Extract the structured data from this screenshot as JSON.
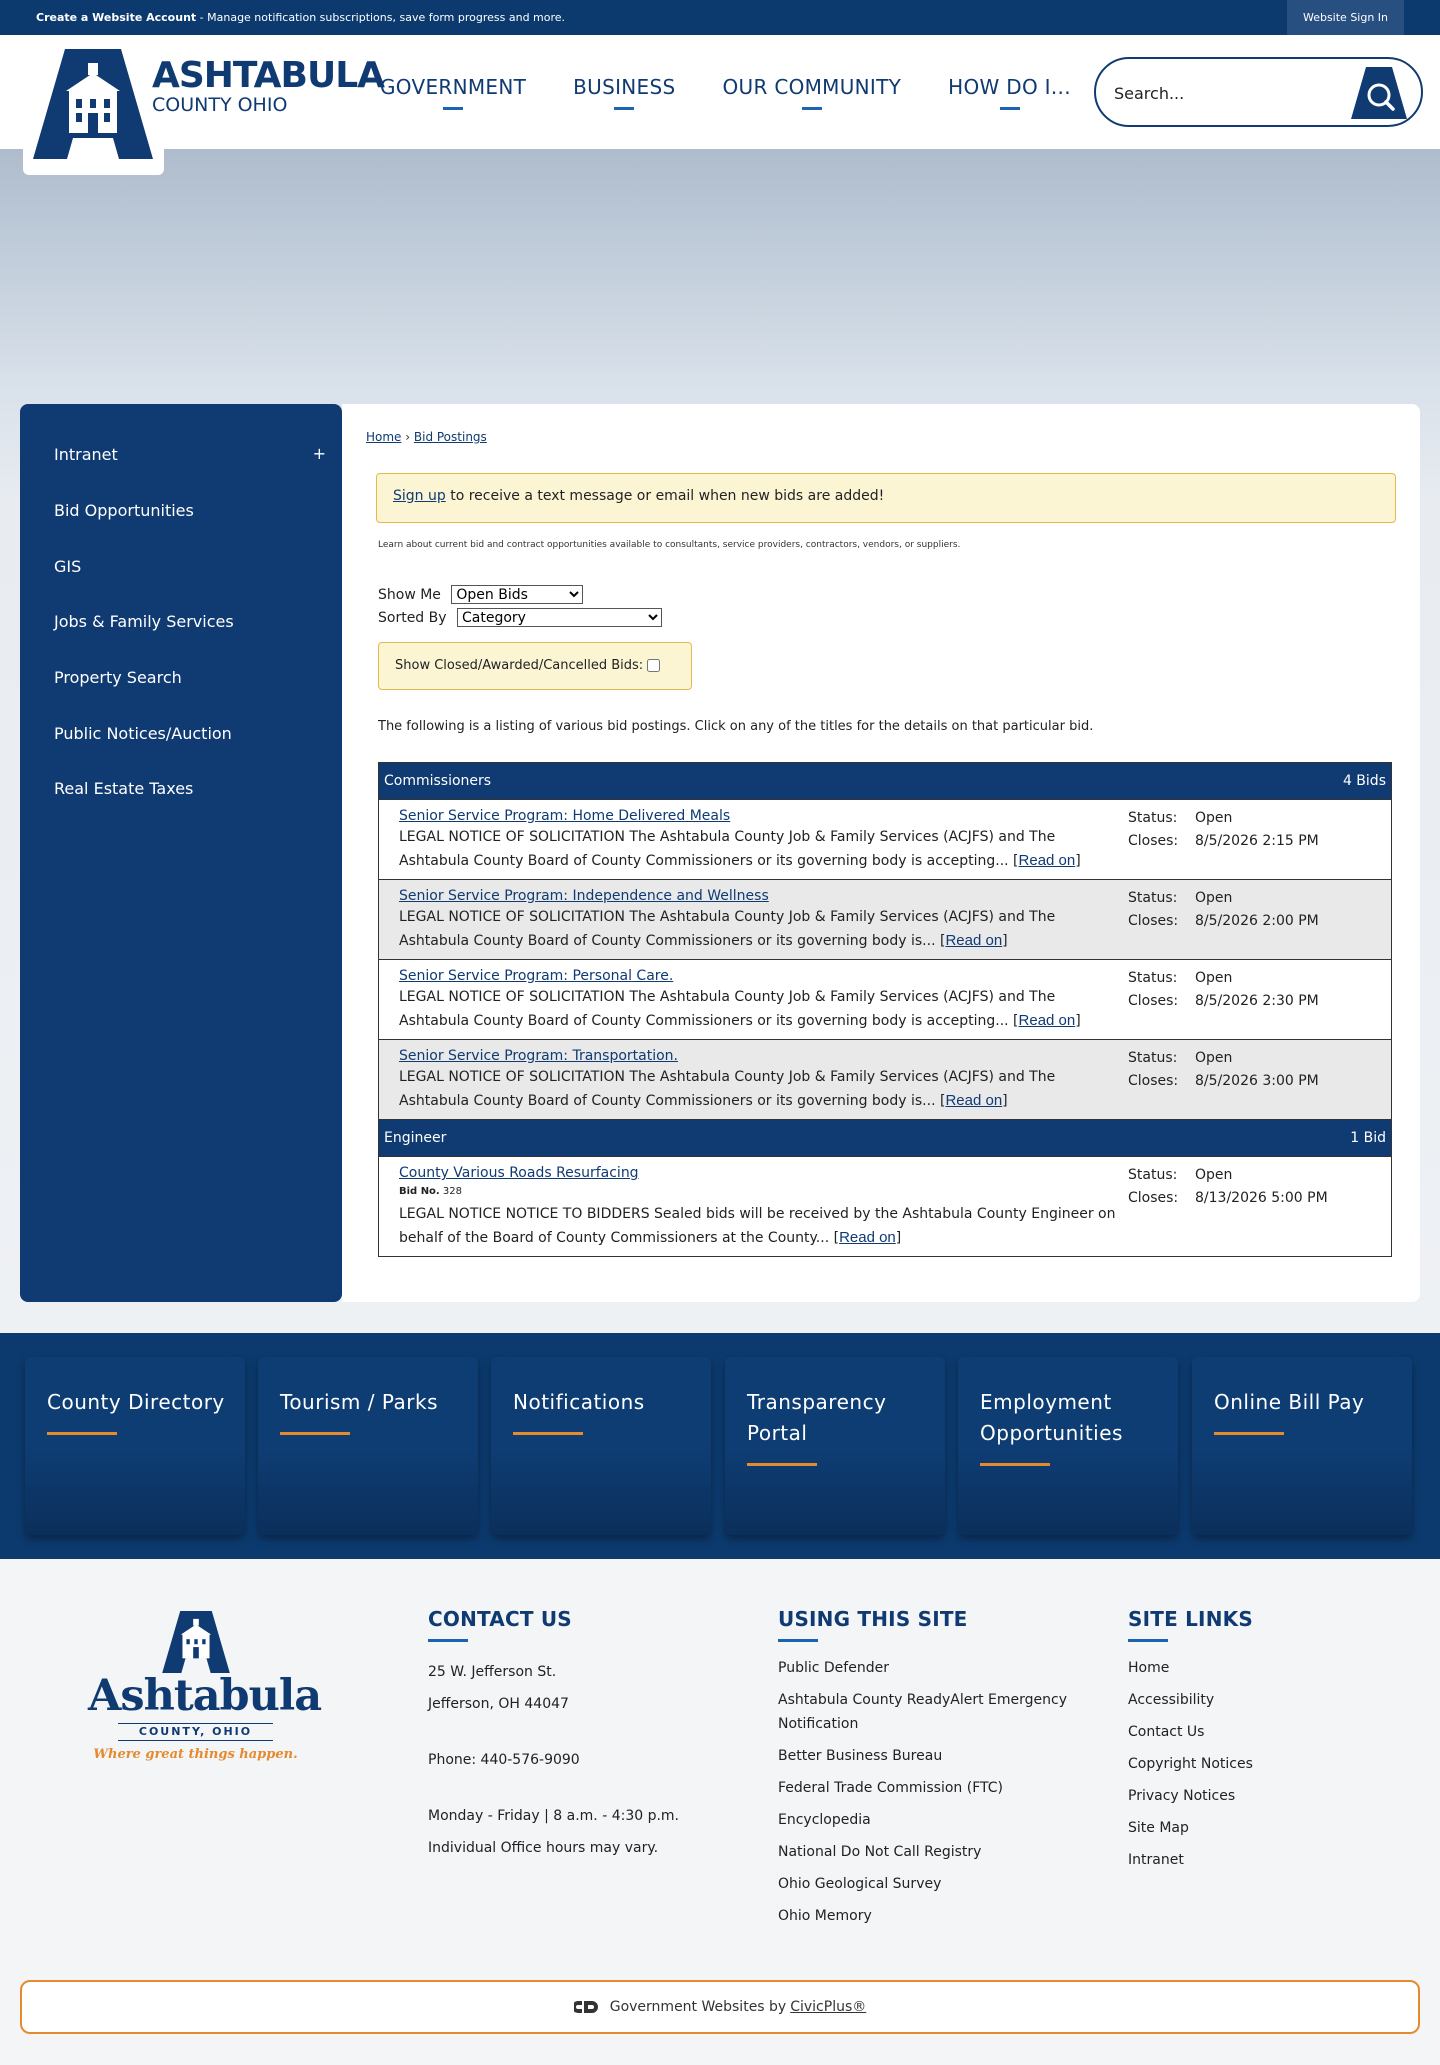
{
  "topbar": {
    "create_account": "Create a Website Account",
    "create_account_desc": " - Manage notification subscriptions, save form progress and more.",
    "sign_in": "Website Sign In"
  },
  "header": {
    "brand_main": "ASHTABULA",
    "brand_sub": "COUNTY OHIO",
    "nav": [
      "GOVERNMENT",
      "BUSINESS",
      "OUR COMMUNITY",
      "HOW DO I..."
    ],
    "search_placeholder": "Search..."
  },
  "sidebar": {
    "items": [
      "Intranet",
      "Bid Opportunities",
      "GIS",
      "Jobs & Family Services",
      "Property Search",
      "Public Notices/Auction",
      "Real Estate Taxes"
    ],
    "expand_symbol": "+"
  },
  "breadcrumb": {
    "home": "Home",
    "sep": " › ",
    "current": "Bid Postings"
  },
  "signup": {
    "link": "Sign up",
    "text": " to receive a text message or email when new bids are added!"
  },
  "intro": "Learn about current bid and contract opportunities available to consultants, service providers, contractors, vendors, or suppliers.",
  "filters": {
    "show_me_label": "Show Me",
    "show_me_value": "Open Bids",
    "sorted_by_label": "Sorted By",
    "sorted_by_value": "Category",
    "closed_label": "Show Closed/Awarded/Cancelled Bids:"
  },
  "listing_intro": "The following is a listing of various bid postings. Click on any of the titles for the details on that particular bid.",
  "labels": {
    "status": "Status:",
    "closes": "Closes:",
    "read_on": "Read on",
    "bid_no": "Bid No."
  },
  "categories": [
    {
      "name": "Commissioners",
      "count": "4 Bids",
      "bids": [
        {
          "title": "Senior Service Program: Home Delivered Meals",
          "desc": "LEGAL NOTICE OF SOLICITATION The Ashtabula County Job & Family Services (ACJFS) and The Ashtabula County Board of County Commissioners or its governing body is accepting... ",
          "status": "Open",
          "closes": "8/5/2026 2:15 PM"
        },
        {
          "title": "Senior Service Program: Independence and Wellness",
          "desc": "LEGAL NOTICE OF SOLICITATION The Ashtabula County Job & Family Services (ACJFS) and The Ashtabula County Board of County Commissioners or its governing body is... ",
          "status": "Open",
          "closes": "8/5/2026 2:00 PM"
        },
        {
          "title": "Senior Service Program: Personal Care.",
          "desc": "LEGAL NOTICE OF SOLICITATION The Ashtabula County Job & Family Services (ACJFS) and The Ashtabula County Board of County Commissioners or its governing body is accepting... ",
          "status": "Open",
          "closes": "8/5/2026 2:30 PM"
        },
        {
          "title": "Senior Service Program: Transportation.",
          "desc": "LEGAL NOTICE OF SOLICITATION The Ashtabula County Job & Family Services (ACJFS) and The Ashtabula County Board of County Commissioners or its governing body is... ",
          "status": "Open",
          "closes": "8/5/2026 3:00 PM"
        }
      ]
    },
    {
      "name": "Engineer",
      "count": "1 Bid",
      "bids": [
        {
          "title": "County Various Roads Resurfacing",
          "bid_no": "328",
          "desc": "LEGAL NOTICE NOTICE TO BIDDERS Sealed bids will be received by the Ashtabula County Engineer on behalf of the Board of County Commissioners at the County... ",
          "status": "Open",
          "closes": "8/13/2026 5:00 PM"
        }
      ]
    }
  ],
  "quick_links": [
    "County Directory",
    "Tourism / Parks",
    "Notifications",
    "Transparency Portal",
    "Employment Opportunities",
    "Online Bill Pay"
  ],
  "footer": {
    "logo_word": "Ashtabula",
    "logo_sub": "COUNTY, OHIO",
    "logo_tag": "Where great things happen.",
    "contact": {
      "heading": "CONTACT US",
      "address1": "25 W. Jefferson St.",
      "address2": "Jefferson, OH 44047",
      "phone": "Phone: 440-576-9090",
      "hours": "Monday - Friday | 8 a.m. - 4:30 p.m.",
      "hours_note": "Individual Office hours may vary."
    },
    "using": {
      "heading": "USING THIS SITE",
      "items": [
        "Public Defender",
        "Ashtabula County ReadyAlert Emergency Notification",
        "Better Business Bureau",
        "Federal Trade Commission (FTC)",
        "Encyclopedia",
        "National Do Not Call Registry",
        "Ohio Geological Survey",
        "Ohio Memory"
      ]
    },
    "site_links": {
      "heading": "SITE LINKS",
      "items": [
        "Home",
        "Accessibility",
        "Contact Us",
        "Copyright Notices",
        "Privacy Notices",
        "Site Map",
        "Intranet"
      ]
    },
    "credit_text": "Government Websites by ",
    "credit_link": "CivicPlus®"
  },
  "colors": {
    "navy": "#0f3a72",
    "accent_orange": "#e68a2e",
    "notice_yellow": "#fbf5d4"
  }
}
